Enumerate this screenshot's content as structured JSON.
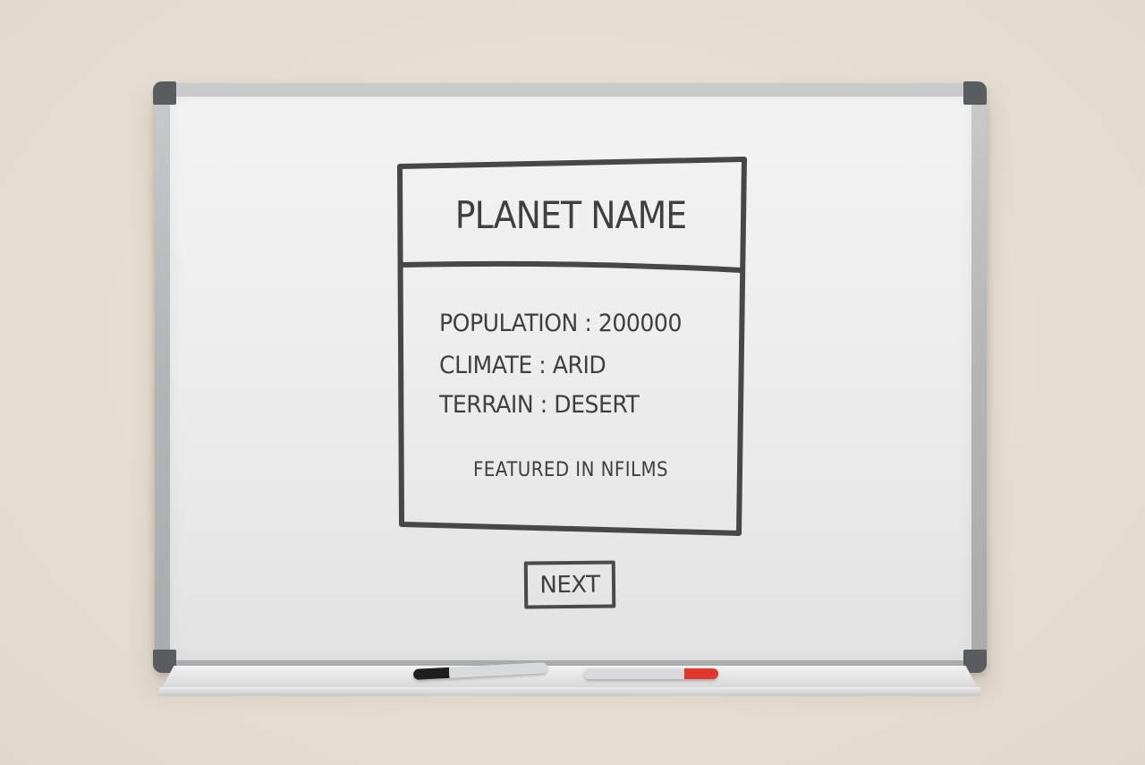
{
  "card": {
    "title": "PLANET NAME",
    "population": "POPULATION : 200000",
    "climate": "CLIMATE : ARID",
    "terrain": "TERRAIN : DESERT",
    "films": "FEATURED IN NFILMS"
  },
  "next_button": {
    "label": "NEXT"
  },
  "colors": {
    "background": "#e8e0d6",
    "board": "#ececec",
    "frame": "#b2b4b5",
    "ink": "#3f3f3f",
    "red_cap": "#e2382b"
  }
}
